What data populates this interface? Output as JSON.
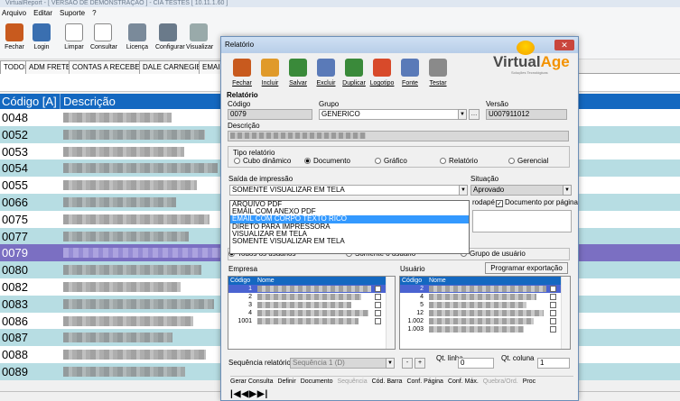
{
  "app": {
    "title": "VirtualReport - [ VERSÃO DE DEMONSTRAÇÃO ] - CIA TESTES [ 10.11.1.60 ]",
    "menu": [
      "Arquivo",
      "Editar",
      "Suporte",
      "?"
    ],
    "toolbar": [
      "Fechar",
      "Login",
      "Limpar",
      "Consultar",
      "Licença",
      "Configurar",
      "Visualizar"
    ],
    "tabs": [
      "TODOS",
      "ADM FRETE",
      "CONTAS A RECEBER",
      "DALE CARNEGIE",
      "EMAIL"
    ],
    "grid": {
      "col_code": "Código [A]",
      "col_desc": "Descrição",
      "rows": [
        "0048",
        "0052",
        "0053",
        "0054",
        "0055",
        "0066",
        "0075",
        "0077",
        "0079",
        "0080",
        "0082",
        "0083",
        "0086",
        "0087",
        "0088",
        "0089"
      ],
      "selected_index": 8
    }
  },
  "dialog": {
    "title": "Relatório",
    "close_icon": "x-close-icon",
    "toolbar": [
      {
        "label": "Fechar",
        "icon": "home-icon",
        "color": "#c85a1e"
      },
      {
        "label": "Incluir",
        "icon": "add-icon",
        "color": "#e09a2a"
      },
      {
        "label": "Salvar",
        "icon": "save-icon",
        "color": "#3a8a3a"
      },
      {
        "label": "Excluir",
        "icon": "delete-icon",
        "color": "#5a7ab8"
      },
      {
        "label": "Duplicar",
        "icon": "duplicate-icon",
        "color": "#3a8a3a"
      },
      {
        "label": "Logotipo",
        "icon": "logo-icon",
        "color": "#d84a2a"
      },
      {
        "label": "Fonte",
        "icon": "font-icon",
        "color": "#5a7ab8"
      },
      {
        "label": "Testar",
        "icon": "print-icon",
        "color": "#8a8a8a"
      }
    ],
    "logo": {
      "name_a": "Virtual",
      "name_b": "Age",
      "tagline": "Soluções Tecnológicas"
    },
    "section_label": "Relatório",
    "codigo_label": "Código",
    "codigo_value": "0079",
    "grupo_label": "Grupo",
    "grupo_value": "GENERICO",
    "versao_label": "Versão",
    "versao_value": "U007911012",
    "descricao_label": "Descrição",
    "tipo_label": "Tipo relatório",
    "tipos": [
      {
        "label": "Cubo dinâmico",
        "checked": false
      },
      {
        "label": "Documento",
        "checked": true
      },
      {
        "label": "Gráfico",
        "checked": false
      },
      {
        "label": "Relatório",
        "checked": false
      },
      {
        "label": "Gerencial",
        "checked": false
      }
    ],
    "saida_label": "Saída de impressão",
    "saida_value": "SOMENTE VISUALIZAR EM TELA",
    "saida_options": [
      "ARQUIVO PDF",
      "EMAIL COM ANEXO PDF",
      "EMAIL COM CORPO TEXTO RICO",
      "DIRETO PARA IMPRESSORA",
      "VISUALIZAR EM TELA",
      "SOMENTE VISUALIZAR EM TELA"
    ],
    "saida_highlight_index": 2,
    "situacao_label": "Situação",
    "situacao_value": "Aprovado",
    "rodape_label": "rodapé",
    "doc_por_pagina_label": "Documento por página",
    "usuarios_radio": [
      "Todos os usuários",
      "Somente o usuário",
      "Grupo de usuário"
    ],
    "programar_button": "Programar exportação",
    "empresa_label": "Empresa",
    "usuario_label": "Usuário",
    "col_codigo": "Código",
    "col_nome": "Nome",
    "empresa_rows": [
      "1",
      "2",
      "3",
      "4",
      "1001"
    ],
    "usuario_rows": [
      "2",
      "4",
      "5",
      "12",
      "1.002",
      "1.003"
    ],
    "sequencia_label": "Sequência relatório",
    "sequencia_value": "Sequência 1 (D)",
    "qt_linha_label": "Qt. linha",
    "qt_linha_value": "0",
    "qt_coluna_label": "Qt. coluna",
    "qt_coluna_value": "1",
    "bottom_tabs": [
      {
        "label": "Gerar Consulta",
        "enabled": true
      },
      {
        "label": "Definir",
        "enabled": true
      },
      {
        "label": "Documento",
        "enabled": true
      },
      {
        "label": "Sequência",
        "enabled": false
      },
      {
        "label": "Cód. Barra",
        "enabled": true
      },
      {
        "label": "Conf. Página",
        "enabled": true
      },
      {
        "label": "Conf. Máx.",
        "enabled": true
      },
      {
        "label": "Quebra/Ord.",
        "enabled": false
      },
      {
        "label": "Proc",
        "enabled": true
      }
    ],
    "nav_glyphs": "|◀◀▶▶|"
  }
}
